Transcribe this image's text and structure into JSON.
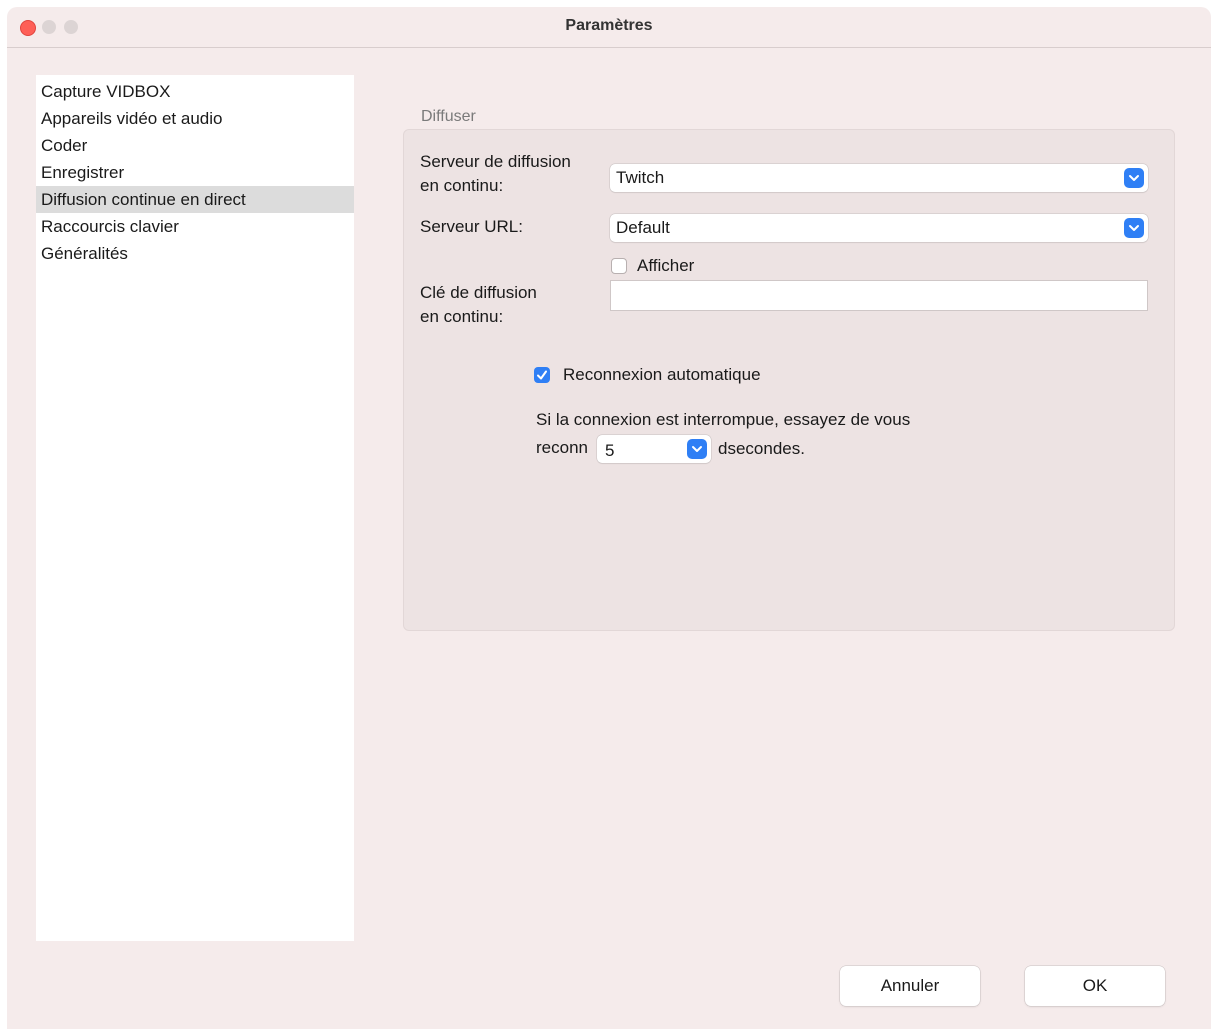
{
  "window": {
    "title": "Paramètres"
  },
  "sidebar": {
    "items": [
      {
        "label": "Capture VIDBOX",
        "selected": false
      },
      {
        "label": "Appareils vidéo et audio",
        "selected": false
      },
      {
        "label": "Coder",
        "selected": false
      },
      {
        "label": "Enregistrer",
        "selected": false
      },
      {
        "label": "Diffusion continue en direct",
        "selected": true
      },
      {
        "label": "Raccourcis clavier",
        "selected": false
      },
      {
        "label": "Généralités",
        "selected": false
      }
    ]
  },
  "stream": {
    "group_title": "Diffuser",
    "server_label_line1": "Serveur de diffusion",
    "server_label_line2": "en continu:",
    "server_value": "Twitch",
    "url_label": "Serveur URL:",
    "url_value": "Default",
    "show_label": "Afficher",
    "show_checked": false,
    "key_label_line1": "Clé de diffusion",
    "key_label_line2": "en continu:",
    "key_value": "",
    "reconnect_label": "Reconnexion automatique",
    "reconnect_checked": true,
    "retry_text_line1": "Si la connexion est interrompue, essayez de vous",
    "retry_text_prefix": "reconn",
    "retry_value": "5",
    "retry_suffix": "dsecondes."
  },
  "footer": {
    "cancel_label": "Annuler",
    "ok_label": "OK"
  },
  "colors": {
    "accent": "#2f7ff5",
    "window_bg": "#f5ebeb",
    "close_button": "#fe5f57"
  }
}
